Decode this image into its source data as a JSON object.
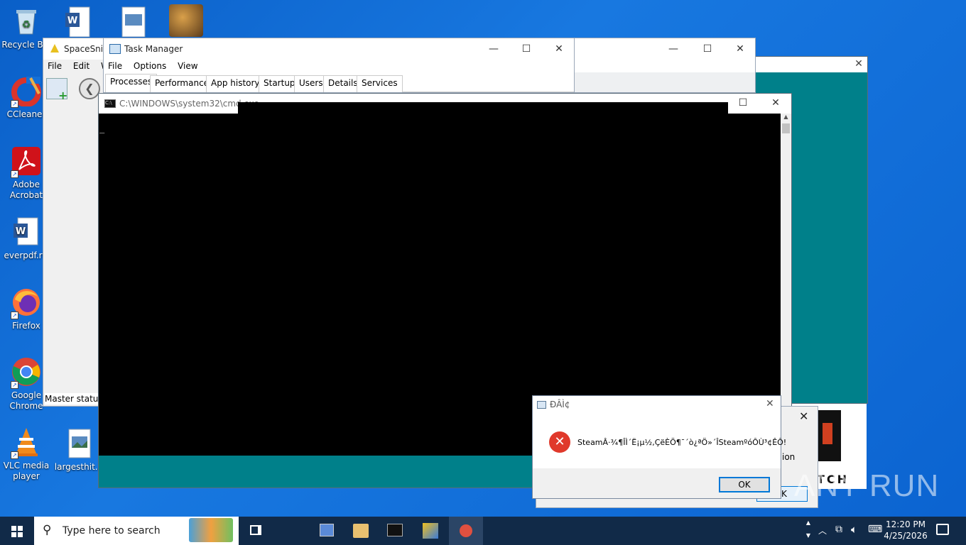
{
  "desktop": {
    "icons": [
      {
        "label": "Recycle Bin",
        "name": "recycle-bin-icon"
      },
      {
        "label": "CCleaner",
        "name": "ccleaner-icon"
      },
      {
        "label": "Adobe Acrobat",
        "name": "adobe-acrobat-icon"
      },
      {
        "label": "everpdf.rtf",
        "name": "word-document-icon"
      },
      {
        "label": "Firefox",
        "name": "firefox-icon"
      },
      {
        "label": "Google Chrome",
        "name": "chrome-icon"
      },
      {
        "label": "VLC media player",
        "name": "vlc-icon"
      },
      {
        "label": "largesthit...",
        "name": "image-file-icon"
      }
    ]
  },
  "spacesniffer": {
    "title": "SpaceSniffer",
    "menu": [
      "File",
      "Edit",
      "W"
    ],
    "status": "Master status:"
  },
  "task_manager": {
    "title": "Task Manager",
    "menu": [
      "File",
      "Options",
      "View"
    ],
    "tabs": [
      "Processes",
      "Performance",
      "App history",
      "Startup",
      "Users",
      "Details",
      "Services"
    ],
    "active_tab": "Processes"
  },
  "cmd": {
    "title": "C:\\WINDOWS\\system32\\cmd.exe",
    "cursor": "_"
  },
  "error_dialog": {
    "title": "ÐÂÌ¢",
    "message": "SteamÂ·¾¶ÎÌ´Ë¡µ½,ÇëÈÖ¶¯´ò¿ªÖ»´ÎSteamºóÔÙ³¢ÊÔ!",
    "ok_label": "OK"
  },
  "background_dialog": {
    "partial_text": "ion",
    "partial_ok": "K"
  },
  "taskbar": {
    "search_placeholder": "Type here to search",
    "time": "12:20 PM",
    "date": "4/25/2026"
  },
  "watermark": "ANY RUN"
}
